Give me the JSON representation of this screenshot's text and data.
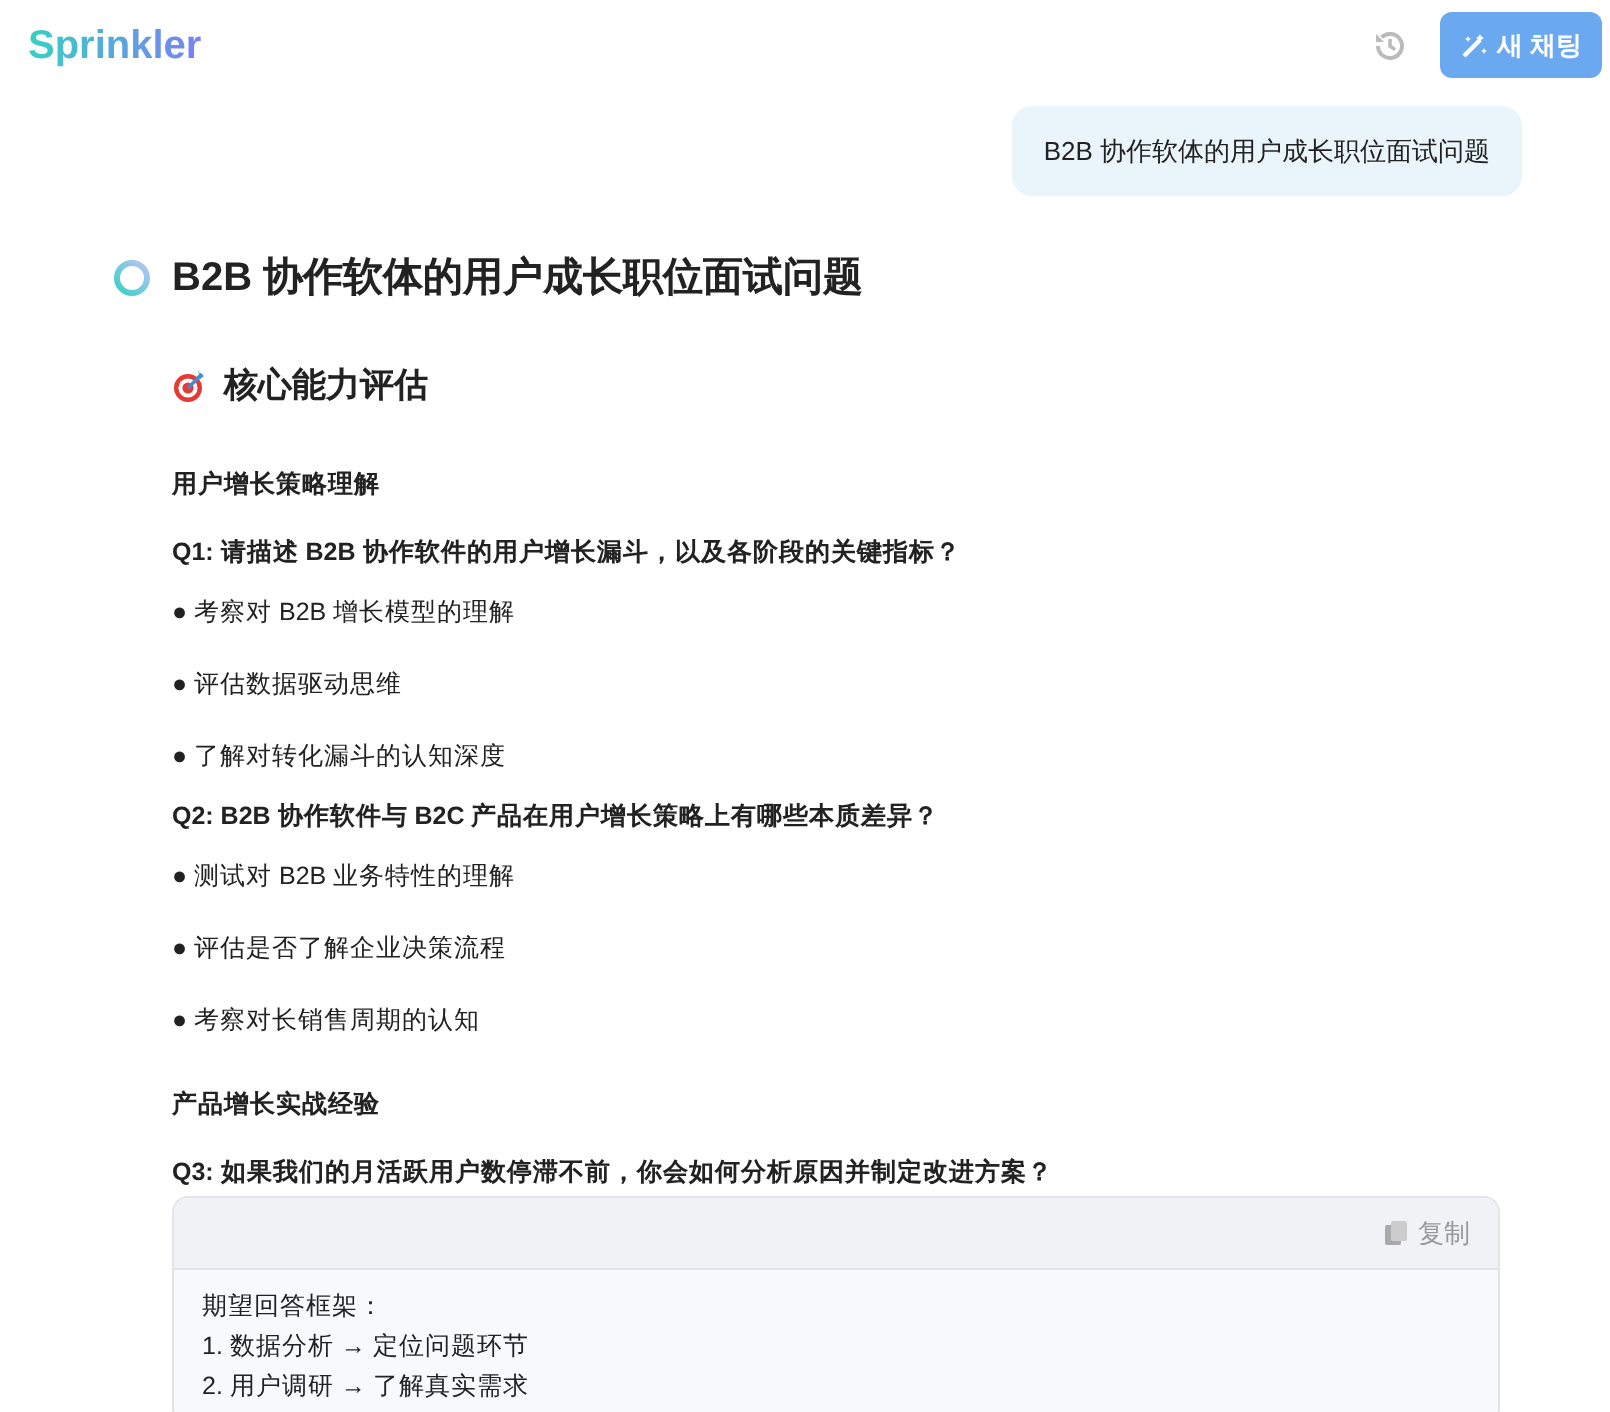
{
  "header": {
    "logo": "Sprinkler",
    "new_chat_button": "새 채팅"
  },
  "user_message": "B2B 协作软体的用户成长职位面试问题",
  "answer": {
    "title": "B2B 协作软体的用户成长职位面试问题",
    "section_heading": "核心能力评估",
    "blocks": [
      {
        "kind": "subheading",
        "text": "用户增长策略理解"
      },
      {
        "kind": "question",
        "text": "Q1: 请描述 B2B 协作软件的用户增长漏斗，以及各阶段的关键指标？"
      },
      {
        "kind": "bullet",
        "text": "● 考察对 B2B 增长模型的理解"
      },
      {
        "kind": "bullet",
        "text": "● 评估数据驱动思维"
      },
      {
        "kind": "bullet",
        "text": "● 了解对转化漏斗的认知深度"
      },
      {
        "kind": "question",
        "text": "Q2: B2B 协作软件与 B2C 产品在用户增长策略上有哪些本质差异？"
      },
      {
        "kind": "bullet",
        "text": "● 测试对 B2B 业务特性的理解"
      },
      {
        "kind": "bullet",
        "text": "● 评估是否了解企业决策流程"
      },
      {
        "kind": "bullet",
        "text": "● 考察对长销售周期的认知"
      },
      {
        "kind": "subheading",
        "text": "产品增长实战经验"
      },
      {
        "kind": "question",
        "text": "Q3: 如果我们的月活跃用户数停滞不前，你会如何分析原因并制定改进方案？"
      },
      {
        "kind": "code",
        "copy_label": "复制",
        "lines": [
          "期望回答框架：",
          "1. 数据分析 → 定位问题环节",
          "2. 用户调研 → 了解真实需求"
        ]
      }
    ]
  }
}
